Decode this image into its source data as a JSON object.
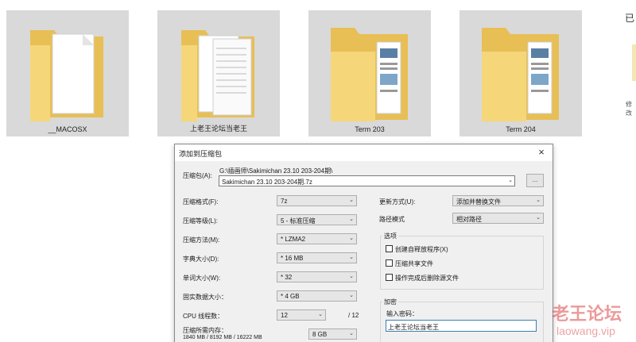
{
  "folders": [
    {
      "name": "__MACOSX"
    },
    {
      "name": "上老王论坛当老王"
    },
    {
      "name": "Term 203"
    },
    {
      "name": "Term 204"
    }
  ],
  "side_panel": {
    "text_top": "已",
    "text_small": "修改"
  },
  "dialog": {
    "title": "添加到压缩包",
    "close_label": "×",
    "archive_label": "压缩包(A):",
    "archive_path": "G:\\插画师\\Sakimichan 23.10 203-204期\\",
    "archive_name": "Sakimichan 23.10 203-204期.7z",
    "browse_label": "...",
    "format": {
      "label": "压缩格式(F):",
      "value": "7z"
    },
    "level": {
      "label": "压缩等级(L):",
      "value": "5 - 标准压缩"
    },
    "method": {
      "label": "压缩方法(M):",
      "value": "* LZMA2"
    },
    "dict": {
      "label": "字典大小(D):",
      "value": "* 16 MB"
    },
    "word": {
      "label": "单词大小(W):",
      "value": "* 32"
    },
    "solid": {
      "label": "固实数据大小：",
      "value": "* 4 GB"
    },
    "cpu": {
      "label": "CPU 线程数：",
      "value": "12",
      "total": "/ 12"
    },
    "memory": {
      "label": "压缩所需内存：",
      "values": "1840 MB / 8192 MB / 16222 MB",
      "value": "8 GB"
    },
    "update": {
      "label": "更新方式(U):",
      "value": "添加并替换文件"
    },
    "pathmode": {
      "label": "路径模式",
      "value": "相对路径"
    },
    "options": {
      "title": "选项",
      "items": [
        {
          "label": "创建自释放程序(X)"
        },
        {
          "label": "压缩共享文件"
        },
        {
          "label": "操作完成后删除源文件"
        }
      ]
    },
    "encryption": {
      "title": "加密",
      "password_label": "输入密码：",
      "password_value": "上老王论坛当老王"
    }
  },
  "watermark": {
    "line1": "老王论坛",
    "line2": "laowang.vip"
  },
  "colors": {
    "folder": "#f5d77a",
    "folder_dark": "#e8bf55",
    "tile_bg": "#d9d9d9",
    "accent": "#3c7fb1"
  }
}
